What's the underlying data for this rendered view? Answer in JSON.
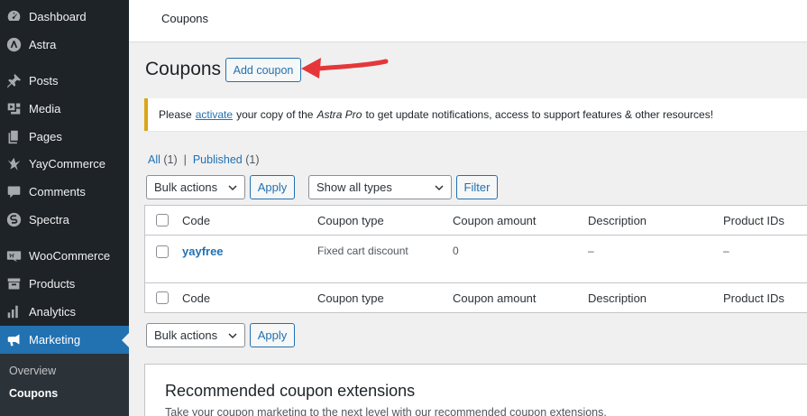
{
  "sidebar": {
    "items": [
      {
        "label": "Dashboard",
        "icon": "dashboard-icon"
      },
      {
        "label": "Astra",
        "icon": "astra-icon"
      },
      {
        "label": "Posts",
        "icon": "pin-icon"
      },
      {
        "label": "Media",
        "icon": "media-icon"
      },
      {
        "label": "Pages",
        "icon": "pages-icon"
      },
      {
        "label": "YayCommerce",
        "icon": "yay-icon"
      },
      {
        "label": "Comments",
        "icon": "comment-icon"
      },
      {
        "label": "Spectra",
        "icon": "spectra-icon"
      },
      {
        "label": "WooCommerce",
        "icon": "woo-icon"
      },
      {
        "label": "Products",
        "icon": "archive-icon"
      },
      {
        "label": "Analytics",
        "icon": "chart-bar-icon"
      },
      {
        "label": "Marketing",
        "icon": "megaphone-icon"
      }
    ],
    "submenu": [
      {
        "label": "Overview"
      },
      {
        "label": "Coupons"
      }
    ]
  },
  "topbar": {
    "title": "Coupons"
  },
  "page": {
    "title": "Coupons",
    "add_button": "Add coupon"
  },
  "notice": {
    "prefix": "Please",
    "link": "activate",
    "middle": "your copy of the",
    "product": "Astra Pro",
    "suffix": "to get update notifications, access to support features & other resources!",
    "accent_color": "#dba617"
  },
  "filters": {
    "all_label": "All",
    "all_count": "(1)",
    "separator": "|",
    "published_label": "Published",
    "published_count": "(1)"
  },
  "controls": {
    "bulk_actions": "Bulk actions",
    "apply": "Apply",
    "type_filter": "Show all types",
    "filter": "Filter"
  },
  "table": {
    "columns": [
      "Code",
      "Coupon type",
      "Coupon amount",
      "Description",
      "Product IDs"
    ],
    "rows": [
      {
        "code": "yayfree",
        "type": "Fixed cart discount",
        "amount": "0",
        "description": "–",
        "product_ids": "–"
      }
    ]
  },
  "recommended": {
    "title": "Recommended coupon extensions",
    "description": "Take your coupon marketing to the next level with our recommended coupon extensions."
  },
  "colors": {
    "accent": "#2271b1",
    "sidebar_bg": "#1d2327",
    "annotation_arrow": "#e5373a"
  }
}
